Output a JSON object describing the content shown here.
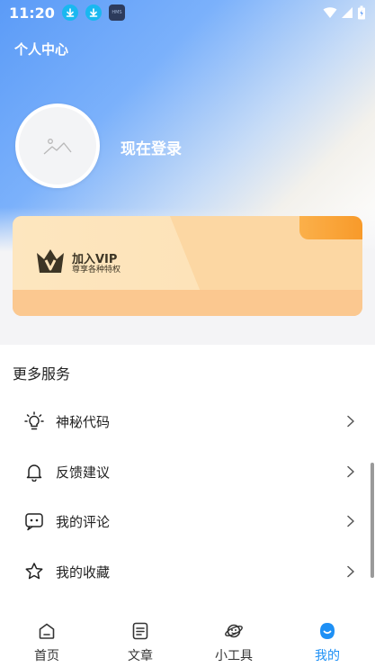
{
  "status_bar": {
    "time": "11:20",
    "app_badge": "HMS"
  },
  "header": {
    "title": "个人中心",
    "login_text": "现在登录"
  },
  "vip": {
    "title": "加入VIP",
    "subtitle": "尊享各种特权"
  },
  "services": {
    "title": "更多服务",
    "items": [
      {
        "label": "神秘代码",
        "icon": "lightbulb-icon"
      },
      {
        "label": "反馈建议",
        "icon": "bell-icon"
      },
      {
        "label": "我的评论",
        "icon": "comment-icon"
      },
      {
        "label": "我的收藏",
        "icon": "star-icon"
      }
    ]
  },
  "nav": {
    "items": [
      {
        "label": "首页",
        "icon": "home-icon"
      },
      {
        "label": "文章",
        "icon": "article-icon"
      },
      {
        "label": "小工具",
        "icon": "planet-icon"
      },
      {
        "label": "我的",
        "icon": "profile-icon",
        "active": true
      }
    ]
  },
  "colors": {
    "accent": "#1e90f5",
    "header_blue": "#5b9bf7",
    "vip_orange": "#f89a2a"
  }
}
